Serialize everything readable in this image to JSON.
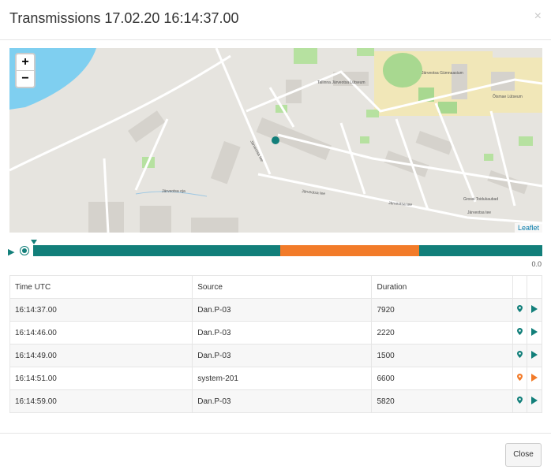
{
  "dialog": {
    "title": "Transmissions 17.02.20 16:14:37.00",
    "close_icon": "×",
    "close_button": "Close"
  },
  "map": {
    "zoom_in": "+",
    "zoom_out": "−",
    "attribution": "Leaflet",
    "labels": {
      "street1": "Järveotsa tee",
      "street2": "Järveotsa tee",
      "street3": "Järveotsa tee",
      "street4": "Järveotsa tee",
      "brook": "Järveotsa oja",
      "school1": "Tallinna Järveotsa Lütseum",
      "school2": "Järveotsa Gümnaasium",
      "school3": "Õismae Lütseum",
      "shop": "Grossi Toidukaubad"
    },
    "colors": {
      "land": "#e6e4df",
      "water": "#7fcff0",
      "park": "#b6e1a0",
      "school": "#f1e7b8",
      "road": "#ffffff",
      "marker": "#127f7a"
    }
  },
  "timeline": {
    "segments": [
      {
        "color": "#127f7a",
        "share": 0.485
      },
      {
        "color": "#f27b29",
        "share": 0.273
      },
      {
        "color": "#127f7a",
        "share": 0.242
      }
    ],
    "value": "0.0"
  },
  "table": {
    "headers": {
      "time": "Time UTC",
      "source": "Source",
      "duration": "Duration"
    },
    "rows": [
      {
        "time": "16:14:37.00",
        "source": "Dan.P-03",
        "duration": "7920",
        "color": "#127f7a"
      },
      {
        "time": "16:14:46.00",
        "source": "Dan.P-03",
        "duration": "2220",
        "color": "#127f7a"
      },
      {
        "time": "16:14:49.00",
        "source": "Dan.P-03",
        "duration": "1500",
        "color": "#127f7a"
      },
      {
        "time": "16:14:51.00",
        "source": "system-201",
        "duration": "6600",
        "color": "#f27b29"
      },
      {
        "time": "16:14:59.00",
        "source": "Dan.P-03",
        "duration": "5820",
        "color": "#127f7a"
      }
    ]
  }
}
